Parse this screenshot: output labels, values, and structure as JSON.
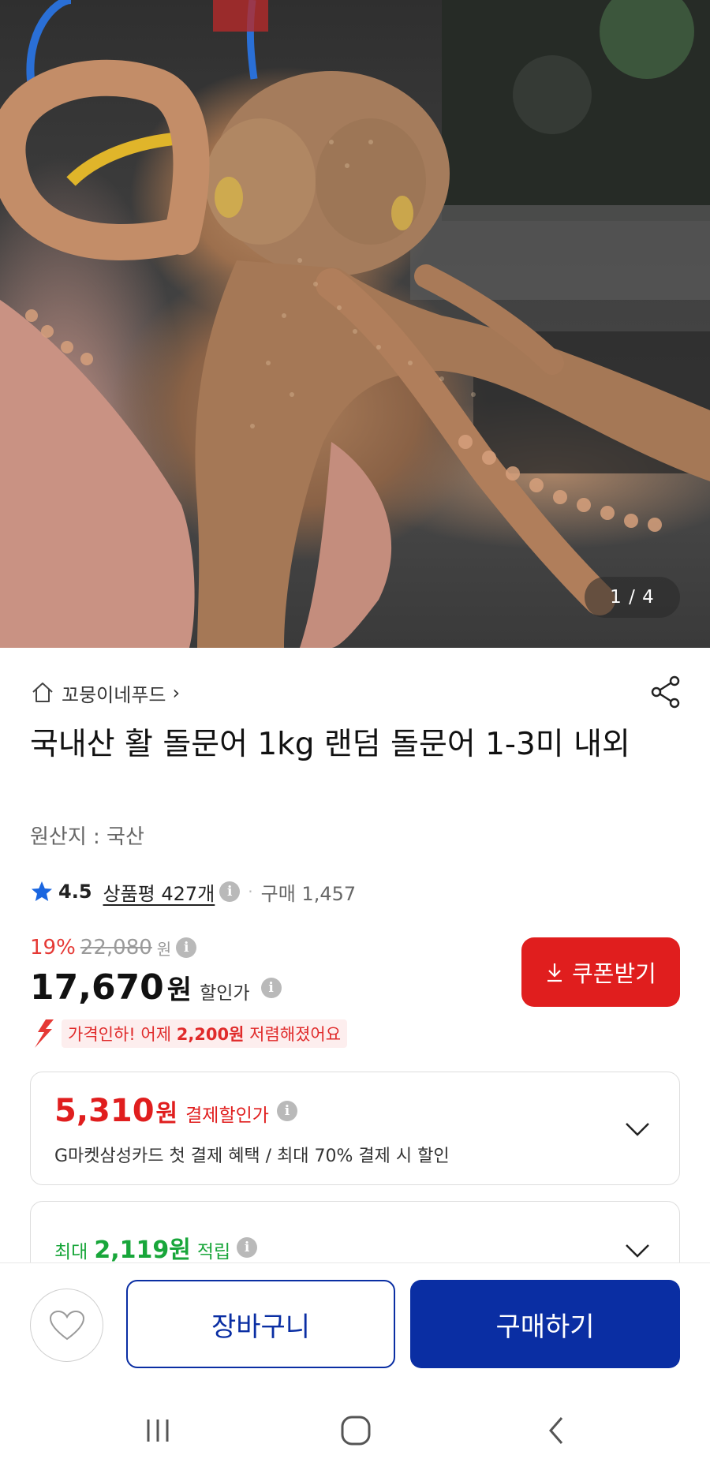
{
  "gallery": {
    "counter": "1 / 4"
  },
  "seller": {
    "name": "꼬뭉이네푸드",
    "chevron": "›",
    "icon": "home-icon"
  },
  "product": {
    "title": "국내산 활 돌문어 1kg 랜덤 돌문어 1-3미 내외",
    "origin": "원산지 : 국산"
  },
  "rating": {
    "value": "4.5",
    "review_label": "상품평 427개",
    "info": "i",
    "separator": "·",
    "purchase_count": "구매 1,457"
  },
  "price": {
    "discount_rate": "19%",
    "original_price": "22,080",
    "original_unit": "원",
    "sale_price": "17,670",
    "sale_unit": "원",
    "sale_label": "할인가",
    "info": "i"
  },
  "coupon": {
    "label": "쿠폰받기",
    "icon": "download-icon"
  },
  "price_drop": {
    "prefix": "가격인하! 어제 ",
    "amount": "2,200원",
    "suffix": " 저렴해졌어요"
  },
  "payment_benefit": {
    "price": "5,310",
    "unit": "원",
    "label": "결제할인가",
    "info": "i",
    "description": "G마켓삼성카드 첫 결제 혜택 / 최대 70% 결제 시 할인"
  },
  "points": {
    "prefix": "최대",
    "value": "2,119원",
    "label": "적립",
    "info": "i"
  },
  "actions": {
    "wishlist_icon": "heart-icon",
    "cart_label": "장바구니",
    "buy_label": "구매하기"
  },
  "colors": {
    "accent_blue": "#0a2ea3",
    "accent_red": "#e01e1e",
    "point_green": "#18a63a",
    "rating_star": "#1a66e0"
  }
}
